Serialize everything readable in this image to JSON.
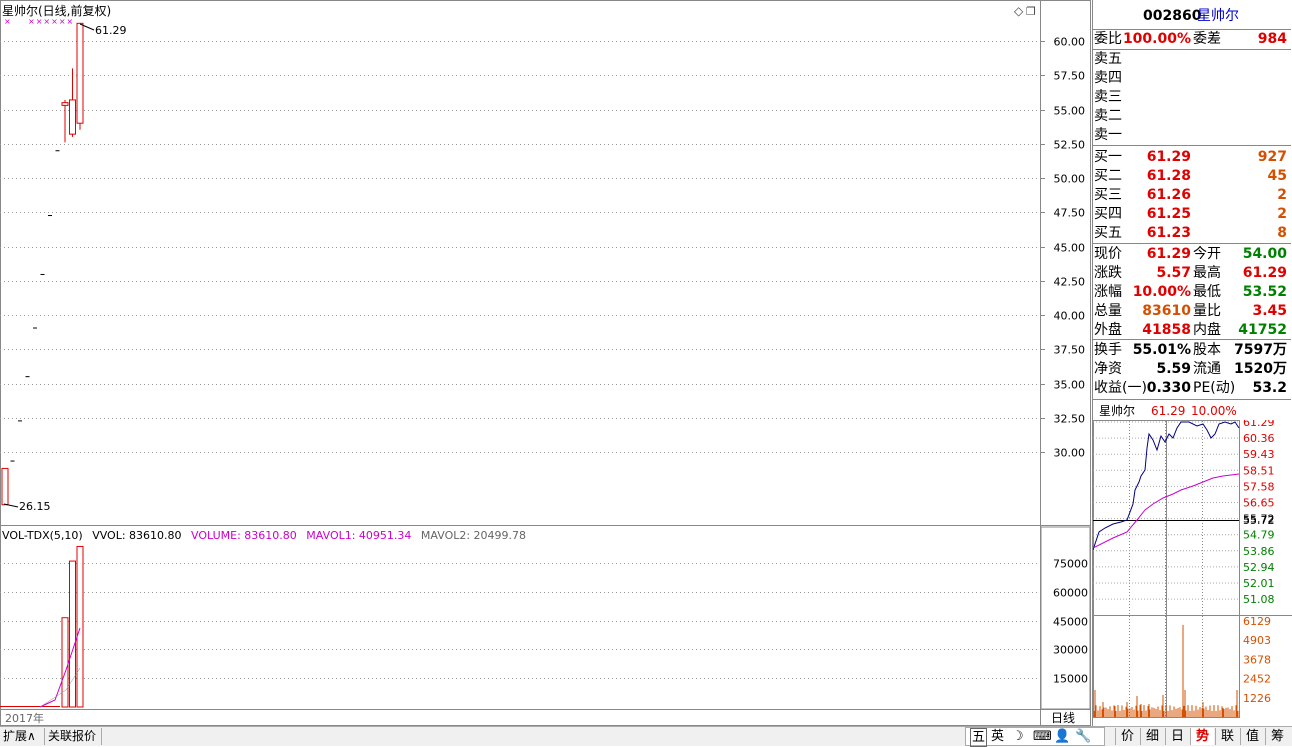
{
  "chart": {
    "title": "星帅尔(日线,前复权)",
    "price_labels": [
      "60.00",
      "57.50",
      "55.00",
      "52.50",
      "50.00",
      "47.50",
      "45.00",
      "42.50",
      "40.00",
      "37.50",
      "35.00",
      "32.50",
      "30.00"
    ],
    "high_marker": "61.29",
    "low_marker": "26.15",
    "period_label": "日线",
    "year_label": "2017年",
    "icons": {
      "diamond": "◇",
      "restore": "❐"
    }
  },
  "volume": {
    "indicator": "VOL-TDX(5,10)",
    "vvol": "VVOL: 83610.80",
    "volume": "VOLUME: 83610.80",
    "mavol1": "MAVOL1: 40951.34",
    "mavol2": "MAVOL2: 20499.78",
    "axis_labels": [
      "75000",
      "60000",
      "45000",
      "30000",
      "15000"
    ],
    "colors": {
      "volume": "#cc00cc",
      "mavol1": "#cc00cc",
      "mavol2": "#666666"
    }
  },
  "chart_data": [
    {
      "type": "candlestick",
      "title": "星帅尔(日线,前复权)",
      "ylim": [
        26.15,
        61.29
      ],
      "candles": [
        {
          "open": 26.15,
          "close": 28.8,
          "high": 28.8,
          "low": 26.15
        },
        {
          "open": 29.34,
          "close": 29.34,
          "high": 29.34,
          "low": 29.34
        },
        {
          "open": 32.27,
          "close": 32.27,
          "high": 32.27,
          "low": 32.27
        },
        {
          "open": 35.5,
          "close": 35.5,
          "high": 35.5,
          "low": 35.5
        },
        {
          "open": 39.05,
          "close": 39.05,
          "high": 39.05,
          "low": 39.05
        },
        {
          "open": 42.96,
          "close": 42.96,
          "high": 42.96,
          "low": 42.96
        },
        {
          "open": 47.26,
          "close": 47.26,
          "high": 47.26,
          "low": 47.26
        },
        {
          "open": 51.99,
          "close": 51.99,
          "high": 51.99,
          "low": 51.99
        },
        {
          "open": 55.3,
          "close": 55.5,
          "high": 55.7,
          "low": 52.6
        },
        {
          "open": 53.2,
          "close": 55.7,
          "high": 58.0,
          "low": 53.0
        },
        {
          "open": 54.0,
          "close": 61.29,
          "high": 61.29,
          "low": 53.52
        }
      ],
      "volume": {
        "values": [
          0,
          0,
          0,
          0,
          0,
          0,
          0,
          0,
          46500,
          76000,
          83610.8
        ],
        "ylim": [
          0,
          85000
        ]
      }
    },
    {
      "type": "line",
      "title": "星帅尔 61.29 10.00%",
      "price_ticks": [
        "61.29",
        "60.36",
        "59.43",
        "58.51",
        "57.58",
        "56.65",
        "55.72",
        "54.79",
        "53.86",
        "52.94",
        "52.01",
        "51.08"
      ],
      "volume_ticks": [
        "6129",
        "4903",
        "3678",
        "2452",
        "1226"
      ],
      "series": [
        {
          "name": "price",
          "color": "#000080"
        },
        {
          "name": "average",
          "color": "#cc00cc"
        }
      ]
    }
  ],
  "quote": {
    "code": "002860",
    "name": "星帅尔",
    "weibi_label": "委比",
    "weibi": "100.00%",
    "weicha_label": "委差",
    "weicha": "984",
    "sell": [
      {
        "label": "卖五"
      },
      {
        "label": "卖四"
      },
      {
        "label": "卖三"
      },
      {
        "label": "卖二"
      },
      {
        "label": "卖一"
      }
    ],
    "buy": [
      {
        "label": "买一",
        "price": "61.29",
        "vol": "927"
      },
      {
        "label": "买二",
        "price": "61.28",
        "vol": "45"
      },
      {
        "label": "买三",
        "price": "61.26",
        "vol": "2"
      },
      {
        "label": "买四",
        "price": "61.25",
        "vol": "2"
      },
      {
        "label": "买五",
        "price": "61.23",
        "vol": "8"
      }
    ],
    "stats": [
      {
        "l1": "现价",
        "v1": "61.29",
        "l2": "今开",
        "v2": "54.00"
      },
      {
        "l1": "涨跌",
        "v1": "5.57",
        "l2": "最高",
        "v2": "61.29"
      },
      {
        "l1": "涨幅",
        "v1": "10.00%",
        "l2": "最低",
        "v2": "53.52"
      },
      {
        "l1": "总量",
        "v1": "83610",
        "l2": "量比",
        "v2": "3.45"
      },
      {
        "l1": "外盘",
        "v1": "41858",
        "l2": "内盘",
        "v2": "41752"
      }
    ],
    "fund": [
      {
        "l1": "换手",
        "v1": "55.01%",
        "l2": "股本",
        "v2": "7597万"
      },
      {
        "l1": "净资",
        "v1": "5.59",
        "l2": "流通",
        "v2": "1520万"
      },
      {
        "l1": "收益(一)",
        "v1": "0.330",
        "l2": "PE(动)",
        "v2": "53.2"
      }
    ],
    "mini_name": "星帅尔",
    "mini_price": "61.29",
    "mini_pct": "10.00%"
  },
  "bottom": {
    "left_tabs": [
      "扩展∧",
      "关联报价"
    ],
    "ime": [
      "五",
      "英",
      "☽",
      "⌨",
      "👤",
      "🔧"
    ],
    "right_tabs": [
      "价",
      "细",
      "日",
      "势",
      "联",
      "值",
      "筹"
    ],
    "active_right_tab": "势"
  }
}
